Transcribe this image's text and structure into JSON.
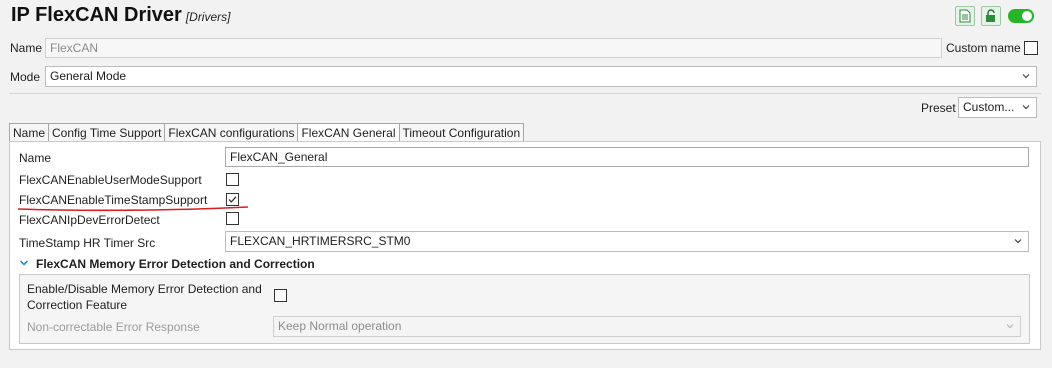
{
  "header": {
    "title": "IP FlexCAN Driver",
    "subtitle": "[Drivers]",
    "enabled": true
  },
  "name_row": {
    "label": "Name",
    "value": "FlexCAN",
    "custom_name_label": "Custom name",
    "custom_name_checked": false
  },
  "mode_row": {
    "label": "Mode",
    "value": "General Mode"
  },
  "preset": {
    "label": "Preset",
    "value": "Custom..."
  },
  "tabs": [
    {
      "label": "Name",
      "active": false
    },
    {
      "label": "Config Time Support",
      "active": false
    },
    {
      "label": "FlexCAN configurations",
      "active": false
    },
    {
      "label": "FlexCAN General",
      "active": true
    },
    {
      "label": "Timeout Configuration",
      "active": false
    }
  ],
  "general": {
    "name_label": "Name",
    "name_value": "FlexCAN_General",
    "user_mode_label": "FlexCANEnableUserModeSupport",
    "user_mode_checked": false,
    "timestamp_label": "FlexCANEnableTimeStampSupport",
    "timestamp_checked": true,
    "dev_error_label": "FlexCANIpDevErrorDetect",
    "dev_error_checked": false,
    "hr_timer_label": "TimeStamp HR Timer Src",
    "hr_timer_value": "FLEXCAN_HRTIMERSRC_STM0"
  },
  "memory_section": {
    "title": "FlexCAN Memory Error Detection and Correction",
    "enable_label_line1": "Enable/Disable Memory Error Detection and",
    "enable_label_line2": "Correction Feature",
    "enable_checked": false,
    "response_label": "Non-correctable Error Response",
    "response_value": "Keep Normal operation"
  },
  "colors": {
    "toggle_on": "#26b526",
    "annotation": "#d81e1e",
    "section_chevron": "#2a8fbf"
  }
}
